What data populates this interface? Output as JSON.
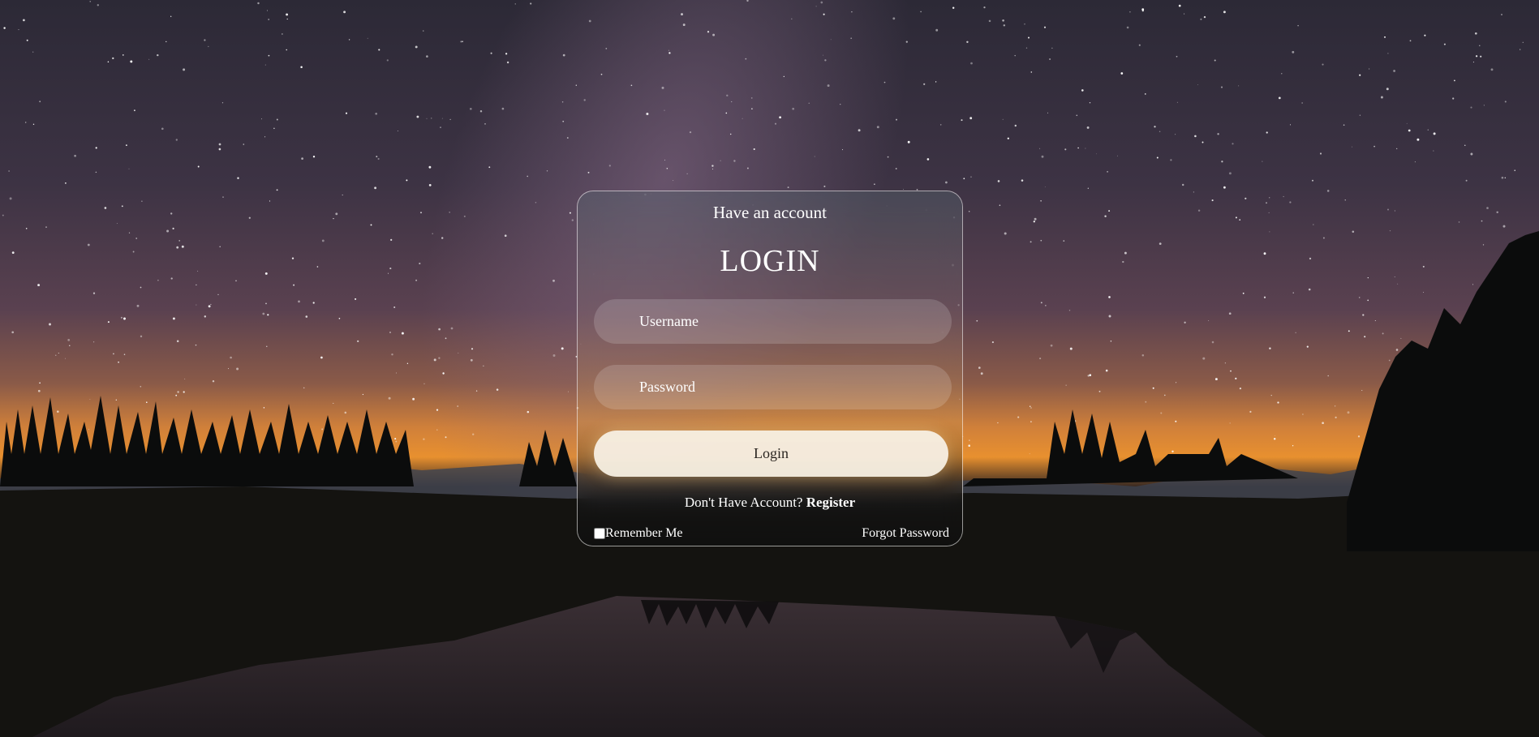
{
  "login": {
    "subtitle": "Have an account",
    "title": "LOGIN",
    "username_placeholder": "Username",
    "password_placeholder": "Password",
    "button_label": "Login",
    "no_account_text": "Don't Have Account?",
    "register_label": "Register",
    "remember_label": "Remember Me",
    "forgot_label": "Forgot Password"
  },
  "colors": {
    "sky_top": "#2c2936",
    "horizon_glow": "#e8902f",
    "ground": "#141310",
    "button_bg": "#f8f0e4",
    "text": "#ffffff"
  }
}
